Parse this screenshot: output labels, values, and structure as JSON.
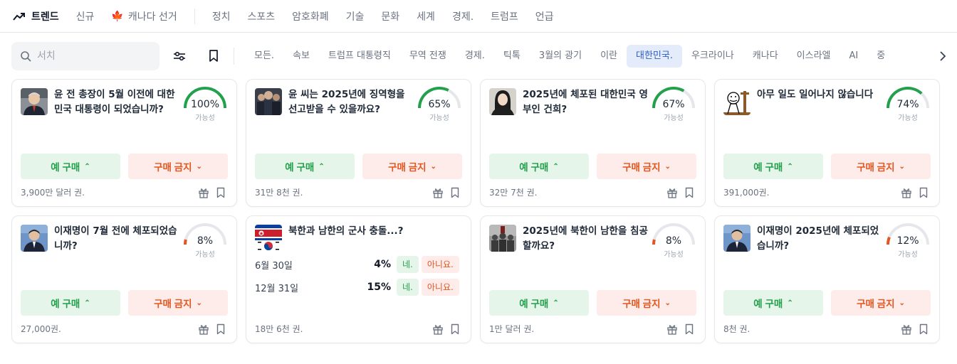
{
  "nav": {
    "trending": "트렌드",
    "new": "신규",
    "canada": "캐나다 선거",
    "categories": [
      "정치",
      "스포츠",
      "암호화폐",
      "기술",
      "문화",
      "세계",
      "경제.",
      "트럼프",
      "언급"
    ]
  },
  "filter": {
    "search_placeholder": "서치",
    "tags": [
      "모든.",
      "속보",
      "트럼프 대통령직",
      "무역 전쟁",
      "경제.",
      "틱톡",
      "3월의 광기",
      "이란",
      "대한민국.",
      "우크라이나",
      "캐나다",
      "이스라엘",
      "AI",
      "중"
    ],
    "active_tag_index": 8
  },
  "common": {
    "yes_label": "예 구매",
    "no_label": "구매 금지",
    "chance_label": "가능성"
  },
  "colors": {
    "green": "#22a04b",
    "red": "#e2561f",
    "active_tag_bg": "#e4ecfb",
    "active_tag_text": "#2f5ec4"
  },
  "cards": [
    {
      "title": "윤 전 총장이 5월 이전에 대한민국 대통령이 되었습니까?",
      "percent": "100%",
      "value": 100,
      "volume": "3,900만 달러 권.",
      "thumb": "person-suit"
    },
    {
      "title": "윤 씨는 2025년에 징역형을 선고받을 수 있을까요?",
      "percent": "65%",
      "value": 65,
      "volume": "31만 8천 권.",
      "thumb": "crowd"
    },
    {
      "title": "2025년에 체포된 대한민국 영부인 건희?",
      "percent": "67%",
      "value": 67,
      "volume": "32만 7천 권.",
      "thumb": "woman"
    },
    {
      "title": "아무 일도 일어나지 않습니다",
      "percent": "74%",
      "value": 74,
      "volume": "391,000권.",
      "thumb": "meme"
    },
    {
      "title": "이재명이 7월 전에 체포되었습니까?",
      "percent": "8%",
      "value": 8,
      "volume": "27,000권.",
      "thumb": "person-blue"
    },
    {
      "title": "북한과 남한의 군사 충돌...?",
      "volume": "18만 6천 권.",
      "thumb": "flags",
      "options": [
        {
          "label": "6월 30일",
          "percent": "4%",
          "yes": "네.",
          "no": "아니요."
        },
        {
          "label": "12월 31일",
          "percent": "15%",
          "yes": "네.",
          "no": "아니요."
        }
      ]
    },
    {
      "title": "2025년에 북한이 남한을 침공할까요?",
      "percent": "8%",
      "value": 8,
      "volume": "1만 달러 권.",
      "thumb": "soldiers"
    },
    {
      "title": "이재명이 2025년에 체포되었습니까?",
      "percent": "12%",
      "value": 12,
      "volume": "8천 권.",
      "thumb": "person-blue"
    }
  ]
}
